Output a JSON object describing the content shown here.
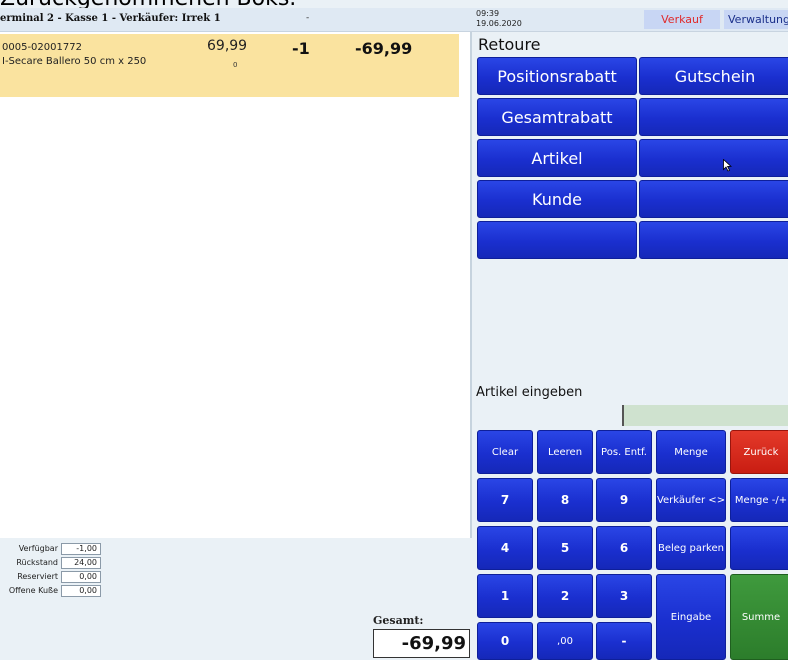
{
  "caption": "Zurückgenommenen Boks.",
  "header": {
    "terminal_info": "erminal 2 - Kasse 1 - Verkäufer: Irrek 1",
    "dash": "-",
    "time": "09:39",
    "date": "19.06.2020",
    "tab_verkauf": "Verkauf",
    "tab_verwaltung": "Verwaltung"
  },
  "item": {
    "article_no": "0005-02001772",
    "name": "I-Secare Ballero 50 cm x 250",
    "price": "69,99",
    "stock_small": "0",
    "qty": "-1",
    "total": "-69,99"
  },
  "stock": [
    {
      "label": "Verfügbar",
      "value": "-1,00"
    },
    {
      "label": "Rückstand",
      "value": "24,00"
    },
    {
      "label": "Reserviert",
      "value": "0,00"
    },
    {
      "label": "Offene Kuße",
      "value": "0,00"
    }
  ],
  "summary": {
    "gesamt_label": "Gesamt:",
    "gesamt_value": "-69,99"
  },
  "mode_title": "Retoure",
  "function_buttons": [
    {
      "label": "Positionsrabatt"
    },
    {
      "label": "Gutschein"
    },
    {
      "label": "Gesamtrabatt"
    },
    {
      "label": ""
    },
    {
      "label": "Artikel"
    },
    {
      "label": ""
    },
    {
      "label": "Kunde"
    },
    {
      "label": ""
    },
    {
      "label": ""
    },
    {
      "label": ""
    }
  ],
  "input": {
    "label": "Artikel eingeben",
    "value": ""
  },
  "keypad": {
    "clear": "Clear",
    "leeren": "Leeren",
    "pos_entf": "Pos. Entf.",
    "menge": "Menge",
    "zurueck": "Zurück",
    "k7": "7",
    "k8": "8",
    "k9": "9",
    "verkaeufer": "Verkäufer <>",
    "menge_pm": "Menge -/+",
    "k4": "4",
    "k5": "5",
    "k6": "6",
    "beleg_parken": "Beleg parken",
    "k1": "1",
    "k2": "2",
    "k3": "3",
    "eingabe": "Eingabe",
    "summe": "Summe",
    "k0": "0",
    "k00": ",00",
    "minus": "-"
  },
  "colors": {
    "button_blue": "#1a2fcf",
    "button_red": "#d42a1c",
    "button_green": "#2c7d2b",
    "item_highlight": "#fae39f"
  }
}
